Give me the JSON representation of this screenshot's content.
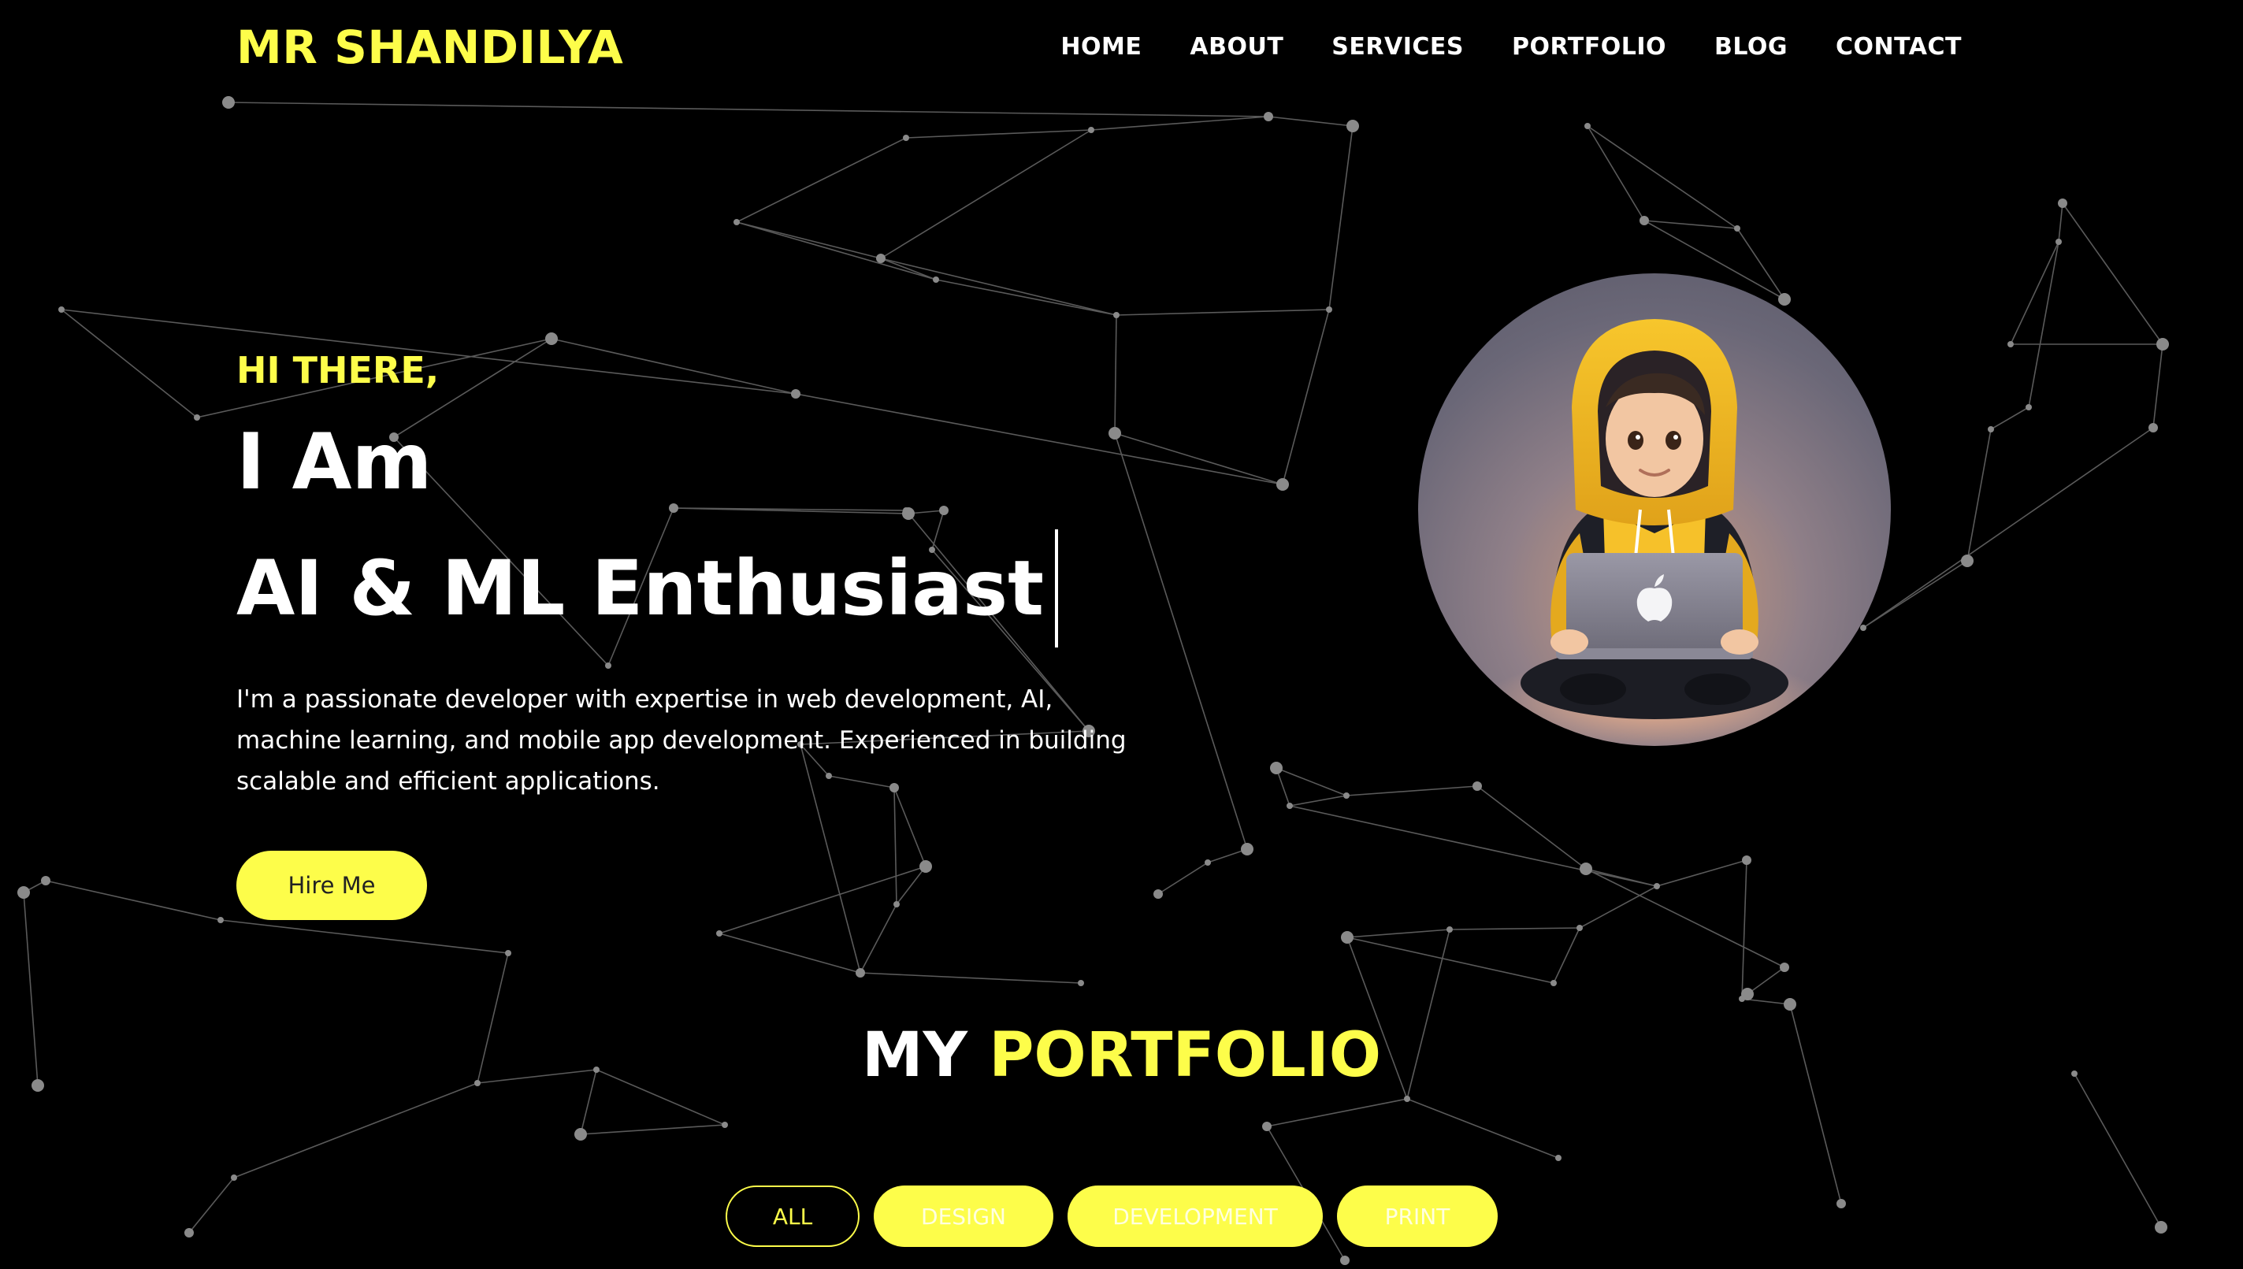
{
  "brand": {
    "name": "MR SHANDILYA"
  },
  "nav": {
    "items": [
      {
        "label": "HOME",
        "active": true
      },
      {
        "label": "ABOUT",
        "active": false
      },
      {
        "label": "SERVICES",
        "active": false
      },
      {
        "label": "PORTFOLIO",
        "active": false
      },
      {
        "label": "BLOG",
        "active": false
      },
      {
        "label": "CONTACT",
        "active": false
      }
    ]
  },
  "hero": {
    "greeting": "HI THERE,",
    "intro": "I Am",
    "role": "AI & ML Enthusiast",
    "description": "I'm a passionate developer with expertise in web development, AI, machine learning, and mobile app development. Experienced in building scalable and efficient applications.",
    "cta_label": "Hire Me"
  },
  "portfolio": {
    "title_prefix": "MY",
    "title_accent": "PORTFOLIO",
    "filters": [
      {
        "label": "ALL",
        "active": true
      },
      {
        "label": "DESIGN",
        "active": false
      },
      {
        "label": "DEVELOPMENT",
        "active": false
      },
      {
        "label": "PRINT",
        "active": false
      }
    ]
  },
  "colors": {
    "accent": "#fdfd4a",
    "background": "#000000",
    "text": "#ffffff",
    "network_lines": "#555555"
  },
  "icons": {
    "avatar": "hoodie-boy-with-laptop-illustration",
    "laptop_logo": "apple-logo-icon"
  }
}
